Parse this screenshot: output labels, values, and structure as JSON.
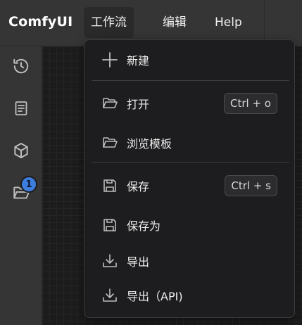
{
  "app": {
    "brand": "ComfyUI"
  },
  "menubar": {
    "items": [
      {
        "label": "工作流",
        "active": true
      },
      {
        "label": "编辑"
      },
      {
        "label": "Help"
      }
    ]
  },
  "sidebar": {
    "items": [
      {
        "icon": "history-icon"
      },
      {
        "icon": "book-icon"
      },
      {
        "icon": "cube-icon"
      },
      {
        "icon": "folder-open-icon",
        "badge": "1"
      }
    ]
  },
  "workflow_menu": {
    "items": [
      {
        "label": "新建",
        "icon": "plus-icon"
      },
      {
        "label": "打开",
        "icon": "folder-open-icon",
        "shortcut": "Ctrl + o"
      },
      {
        "label": "浏览模板",
        "icon": "folder-open-icon"
      },
      {
        "label": "保存",
        "icon": "save-icon",
        "shortcut": "Ctrl + s"
      },
      {
        "label": "保存为",
        "icon": "save-icon"
      },
      {
        "label": "导出",
        "icon": "download-icon"
      },
      {
        "label": "导出（API)",
        "icon": "download-icon"
      }
    ]
  },
  "colors": {
    "topbar": "#353535",
    "menu_bg": "#1d1d1f",
    "badge": "#3d7dde"
  }
}
